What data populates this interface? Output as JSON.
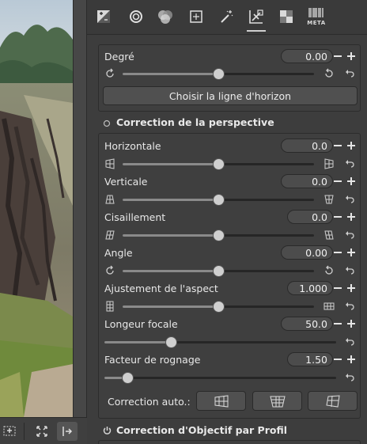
{
  "tabs": [
    {
      "icon": "exposure-icon"
    },
    {
      "icon": "detail-icon"
    },
    {
      "icon": "color-icon"
    },
    {
      "icon": "advanced-icon"
    },
    {
      "icon": "wand-icon"
    },
    {
      "icon": "transform-icon",
      "active": true
    },
    {
      "icon": "raw-icon"
    },
    {
      "icon": "metadata-icon",
      "label": "META"
    }
  ],
  "rotate": {
    "label": "Degré",
    "value": "0.00",
    "slider_fraction": 0.5,
    "horizon_button": "Choisir la ligne d'horizon"
  },
  "perspective": {
    "title": "Correction de la perspective",
    "rows": [
      {
        "label": "Horizontale",
        "value": "0.0",
        "fraction": 0.5
      },
      {
        "label": "Verticale",
        "value": "0.0",
        "fraction": 0.5
      },
      {
        "label": "Cisaillement",
        "value": "0.0",
        "fraction": 0.5
      },
      {
        "label": "Angle",
        "value": "0.00",
        "fraction": 0.5
      },
      {
        "label": "Ajustement de l'aspect",
        "value": "1.000",
        "fraction": 0.5
      },
      {
        "label": "Longeur focale",
        "value": "50.0",
        "fraction": 0.29
      },
      {
        "label": "Facteur de rognage",
        "value": "1.50",
        "fraction": 0.1
      }
    ],
    "auto_label": "Correction auto.:"
  },
  "lens": {
    "title": "Correction d'Objectif par Profil"
  },
  "colors": {
    "panel": "#3d3d3d",
    "knob": "#cfcfcf",
    "track": "#262626"
  }
}
